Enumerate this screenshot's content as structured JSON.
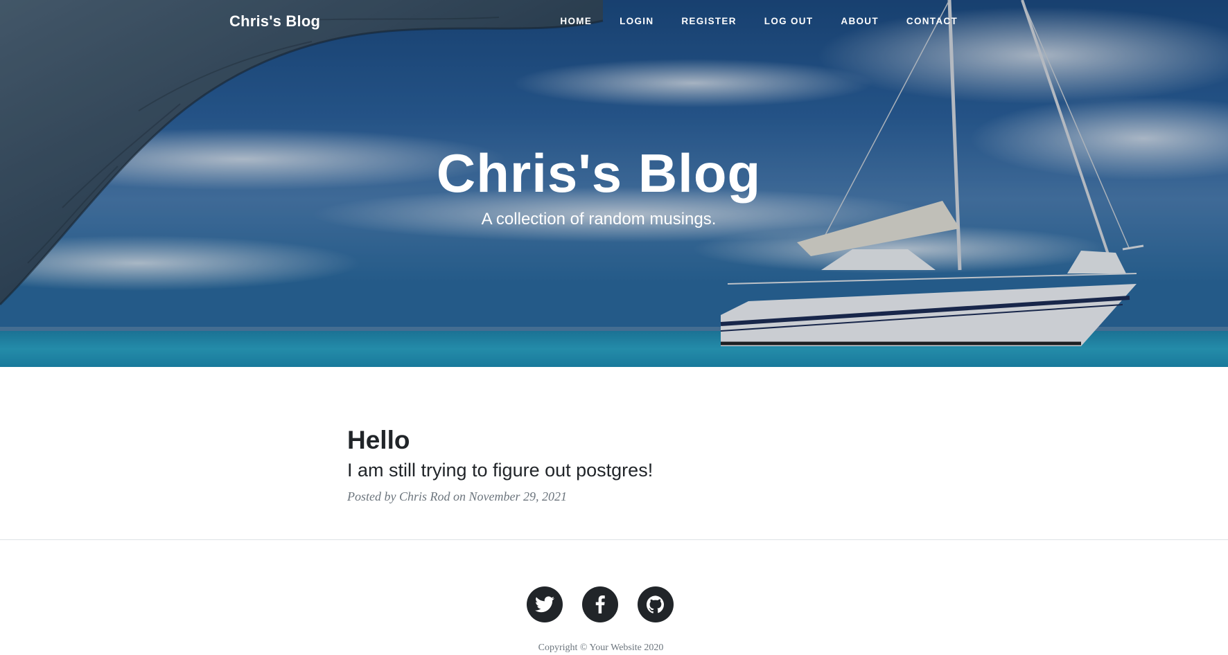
{
  "nav": {
    "brand": "Chris's Blog",
    "links": [
      "HOME",
      "LOGIN",
      "REGISTER",
      "LOG OUT",
      "ABOUT",
      "CONTACT"
    ]
  },
  "hero": {
    "title": "Chris's Blog",
    "subtitle": "A collection of random musings."
  },
  "posts": [
    {
      "title": "Hello",
      "subtitle": "I am still trying to figure out postgres!",
      "meta": "Posted by Chris Rod on November 29, 2021"
    }
  ],
  "footer": {
    "social_icons": [
      "twitter-icon",
      "facebook-icon",
      "github-icon"
    ],
    "copyright": "Copyright © Your Website 2020"
  },
  "colors": {
    "text": "#212529",
    "muted": "#6c757d",
    "social_bg": "#212529",
    "divider": "#dee2e6"
  }
}
